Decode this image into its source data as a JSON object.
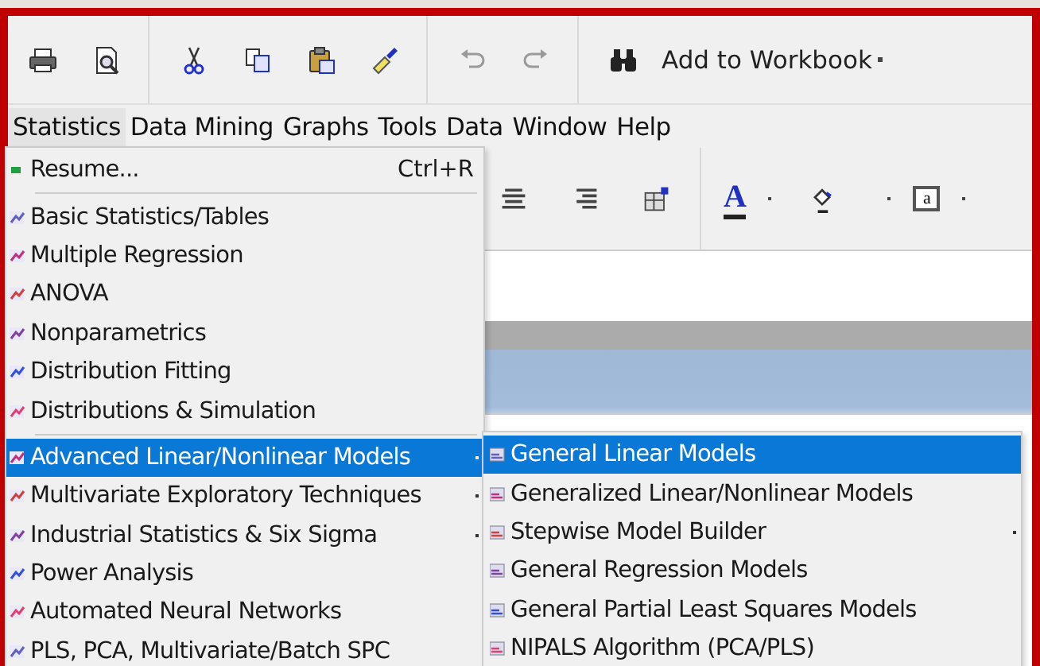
{
  "toolbar": {
    "workbook_button": "Add to Workbook"
  },
  "menu_bar": [
    {
      "label": "Statistics",
      "selected": true
    },
    {
      "label": "Data Mining",
      "selected": false
    },
    {
      "label": "Graphs",
      "selected": false
    },
    {
      "label": "Tools",
      "selected": false
    },
    {
      "label": "Data",
      "selected": false
    },
    {
      "label": "Window",
      "selected": false
    },
    {
      "label": "Help",
      "selected": false
    }
  ],
  "format_toolbar": {
    "font_color_glyph": "A",
    "text_box_glyph": "a"
  },
  "statistics_menu": [
    {
      "kind": "item",
      "label": "Resume...",
      "shortcut": "Ctrl+R",
      "selected": false,
      "submenu": false
    },
    {
      "kind": "separator"
    },
    {
      "kind": "item",
      "label": "Basic Statistics/Tables",
      "selected": false,
      "submenu": false
    },
    {
      "kind": "item",
      "label": "Multiple Regression",
      "selected": false,
      "submenu": false
    },
    {
      "kind": "item",
      "label": "ANOVA",
      "selected": false,
      "submenu": false
    },
    {
      "kind": "item",
      "label": "Nonparametrics",
      "selected": false,
      "submenu": false
    },
    {
      "kind": "item",
      "label": "Distribution Fitting",
      "selected": false,
      "submenu": false
    },
    {
      "kind": "item",
      "label": "Distributions & Simulation",
      "selected": false,
      "submenu": false
    },
    {
      "kind": "separator"
    },
    {
      "kind": "item",
      "label": "Advanced Linear/Nonlinear Models",
      "selected": true,
      "submenu": true
    },
    {
      "kind": "item",
      "label": "Multivariate Exploratory Techniques",
      "selected": false,
      "submenu": true
    },
    {
      "kind": "item",
      "label": "Industrial Statistics & Six Sigma",
      "selected": false,
      "submenu": true
    },
    {
      "kind": "item",
      "label": "Power Analysis",
      "selected": false,
      "submenu": false
    },
    {
      "kind": "item",
      "label": "Automated Neural Networks",
      "selected": false,
      "submenu": false
    },
    {
      "kind": "item",
      "label": "PLS, PCA, Multivariate/Batch SPC",
      "selected": false,
      "submenu": false
    }
  ],
  "submenu": [
    {
      "label": "General Linear Models",
      "selected": true,
      "submenu": false
    },
    {
      "label": "Generalized Linear/Nonlinear Models",
      "selected": false,
      "submenu": false
    },
    {
      "label": "Stepwise Model Builder",
      "selected": false,
      "submenu": true
    },
    {
      "label": "General Regression Models",
      "selected": false,
      "submenu": false
    },
    {
      "label": "General Partial Least Squares Models",
      "selected": false,
      "submenu": false
    },
    {
      "label": "NIPALS Algorithm (PCA/PLS)",
      "selected": false,
      "submenu": false
    }
  ]
}
